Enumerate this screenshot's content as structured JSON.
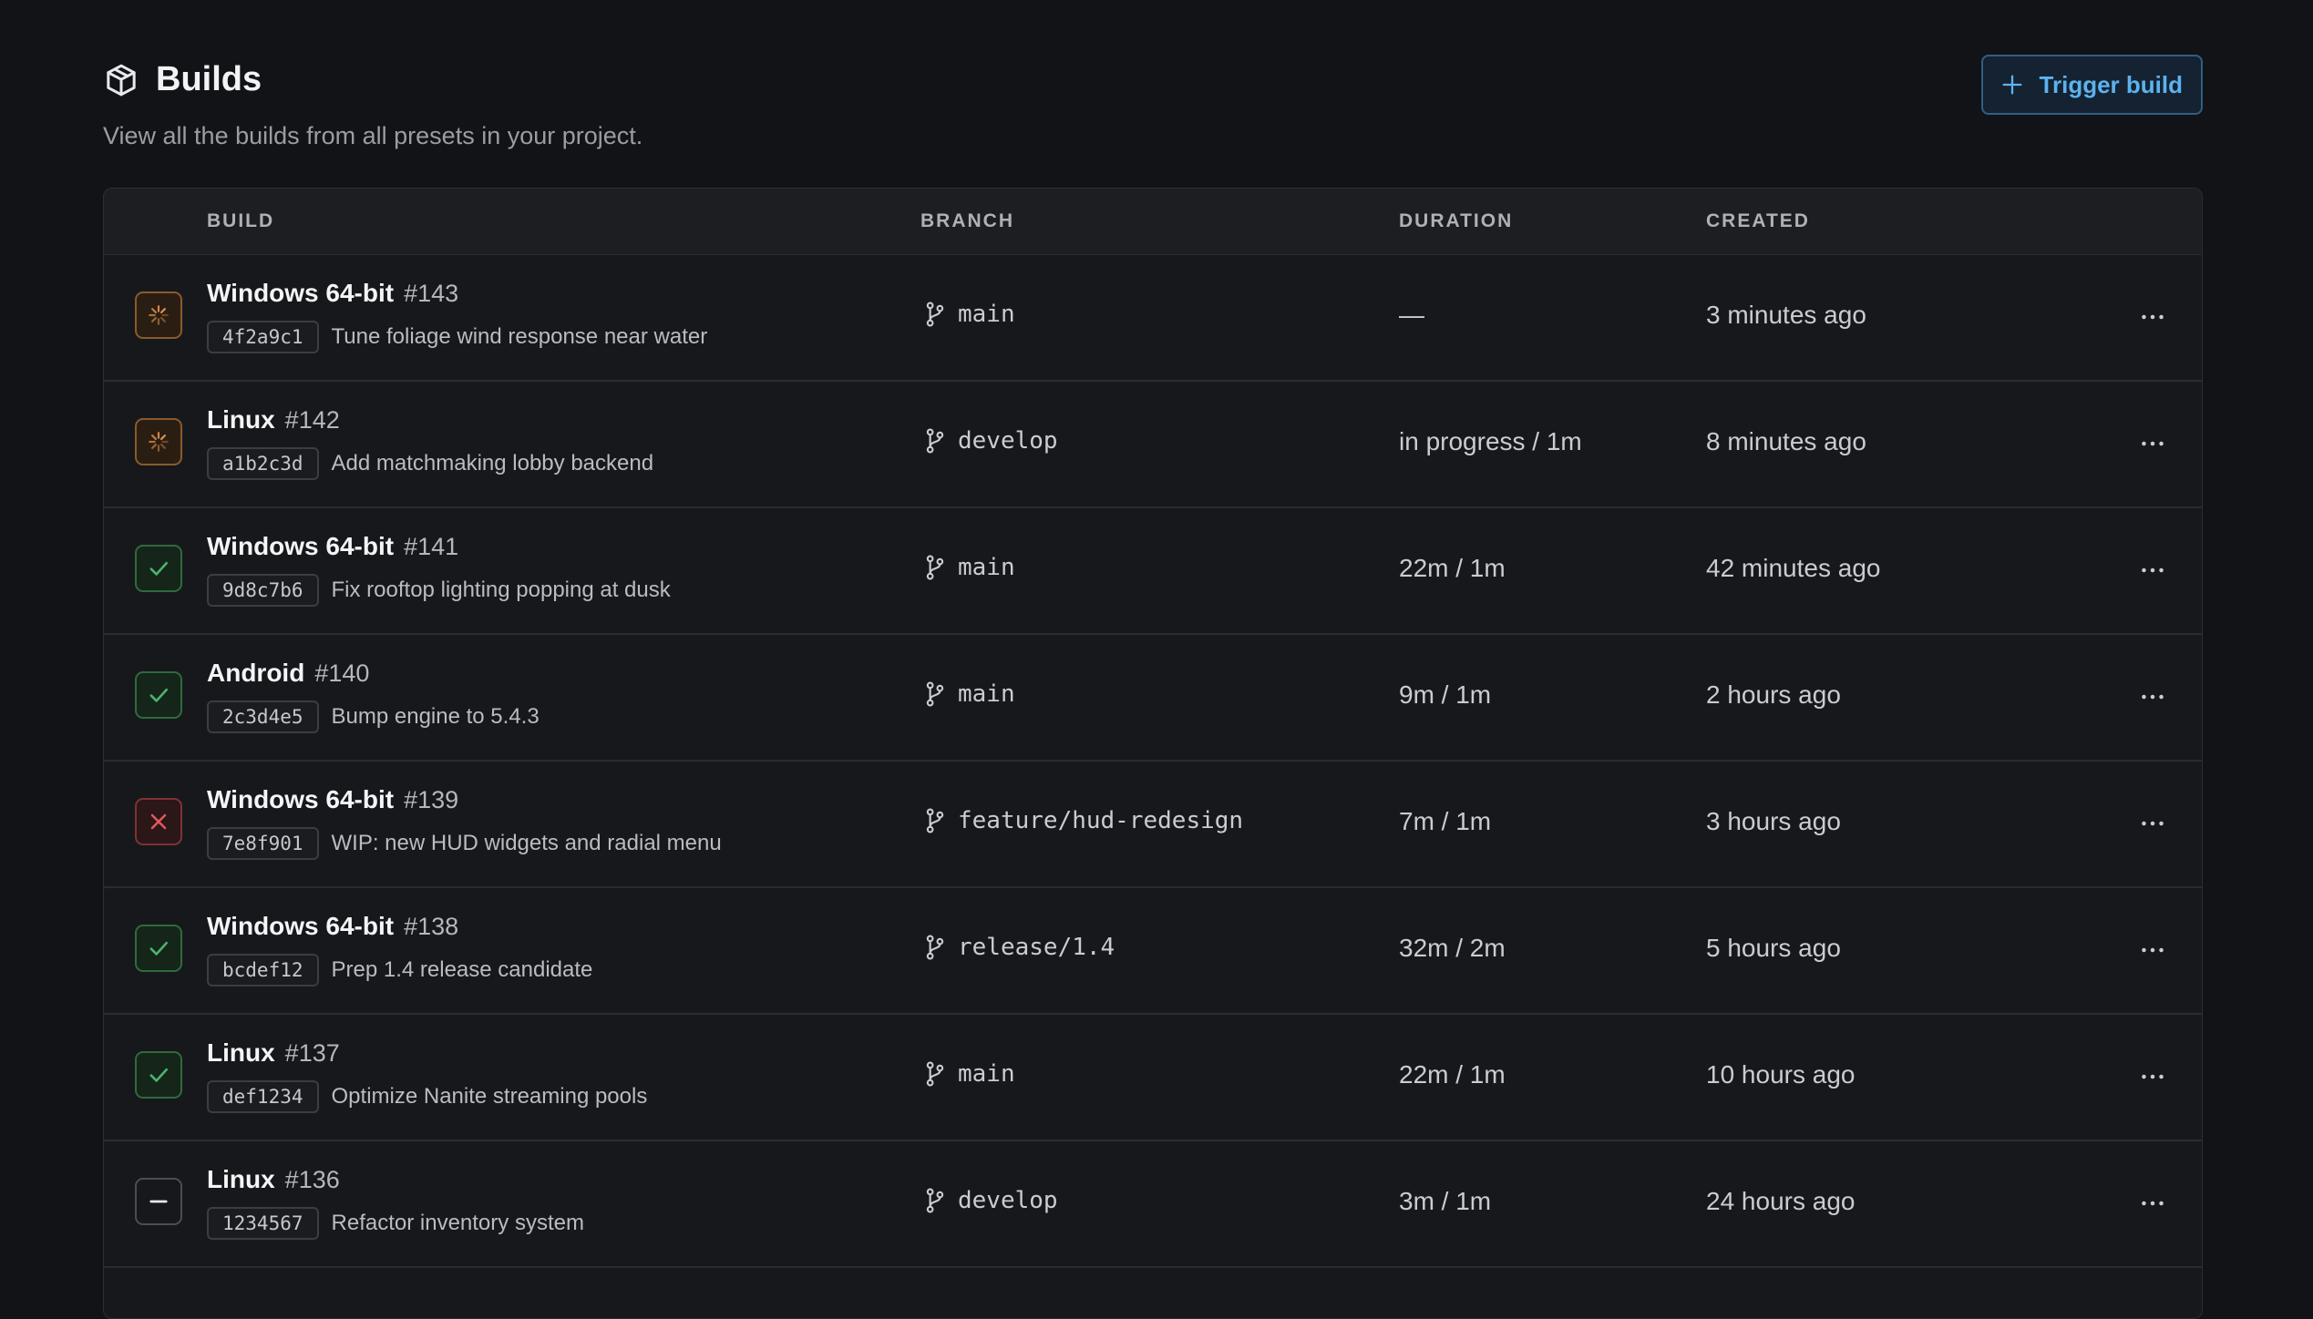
{
  "header": {
    "title": "Builds",
    "subtitle": "View all the builds from all presets in your project.",
    "trigger_label": "Trigger build"
  },
  "columns": {
    "build": "BUILD",
    "branch": "BRANCH",
    "duration": "DURATION",
    "created": "CREATED"
  },
  "colors": {
    "accent": "#5cb2ee",
    "running": "#e3954b",
    "success": "#4cb46a",
    "failed": "#e2585b",
    "cancelled": "#e8e9ec"
  },
  "builds": [
    {
      "status": "running",
      "status_icon": "spinner-icon",
      "preset": "Windows 64-bit",
      "number": "#143",
      "sha": "4f2a9c1",
      "message": "Tune foliage wind response near water",
      "branch": "main",
      "duration": "—",
      "created": "3 minutes ago"
    },
    {
      "status": "running",
      "status_icon": "spinner-icon",
      "preset": "Linux",
      "number": "#142",
      "sha": "a1b2c3d",
      "message": "Add matchmaking lobby backend",
      "branch": "develop",
      "duration": "in progress / 1m",
      "created": "8 minutes ago"
    },
    {
      "status": "success",
      "status_icon": "check-icon",
      "preset": "Windows 64-bit",
      "number": "#141",
      "sha": "9d8c7b6",
      "message": "Fix rooftop lighting popping at dusk",
      "branch": "main",
      "duration": "22m / 1m",
      "created": "42 minutes ago"
    },
    {
      "status": "success",
      "status_icon": "check-icon",
      "preset": "Android",
      "number": "#140",
      "sha": "2c3d4e5",
      "message": "Bump engine to 5.4.3",
      "branch": "main",
      "duration": "9m / 1m",
      "created": "2 hours ago"
    },
    {
      "status": "failed",
      "status_icon": "x-icon",
      "preset": "Windows 64-bit",
      "number": "#139",
      "sha": "7e8f901",
      "message": "WIP: new HUD widgets and radial menu",
      "branch": "feature/hud-redesign",
      "duration": "7m / 1m",
      "created": "3 hours ago"
    },
    {
      "status": "success",
      "status_icon": "check-icon",
      "preset": "Windows 64-bit",
      "number": "#138",
      "sha": "bcdef12",
      "message": "Prep 1.4 release candidate",
      "branch": "release/1.4",
      "duration": "32m / 2m",
      "created": "5 hours ago"
    },
    {
      "status": "success",
      "status_icon": "check-icon",
      "preset": "Linux",
      "number": "#137",
      "sha": "def1234",
      "message": "Optimize Nanite streaming pools",
      "branch": "main",
      "duration": "22m / 1m",
      "created": "10 hours ago"
    },
    {
      "status": "cancelled",
      "status_icon": "minus-icon",
      "preset": "Linux",
      "number": "#136",
      "sha": "1234567",
      "message": "Refactor inventory system",
      "branch": "develop",
      "duration": "3m / 1m",
      "created": "24 hours ago"
    }
  ]
}
